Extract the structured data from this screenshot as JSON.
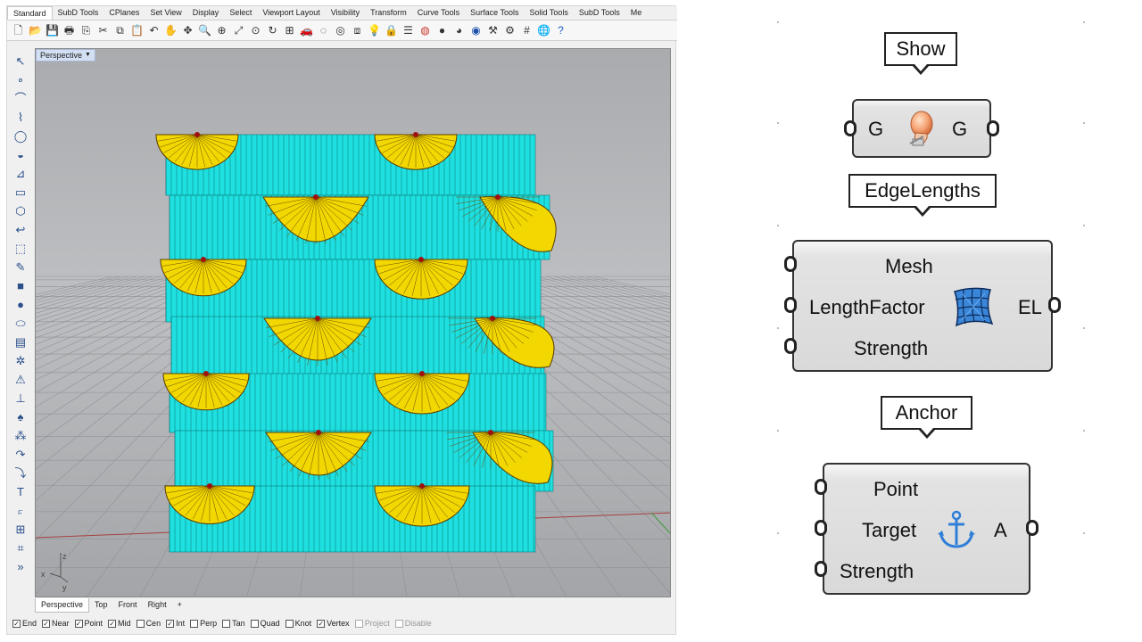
{
  "rhino": {
    "menu_tabs": [
      "Standard",
      "SubD Tools",
      "CPlanes",
      "Set View",
      "Display",
      "Select",
      "Viewport Layout",
      "Visibility",
      "Transform",
      "Curve Tools",
      "Surface Tools",
      "Solid Tools",
      "SubD Tools",
      "Me"
    ],
    "active_menu_tab": "Standard",
    "toolbar_icons": [
      "new-file-icon",
      "open-file-icon",
      "save-icon",
      "print-icon",
      "import-icon",
      "cut-icon",
      "copy-icon",
      "paste-icon",
      "undo-icon",
      "pan-icon",
      "move-view-icon",
      "zoom-icon",
      "zoom-window-icon",
      "zoom-extents-icon",
      "zoom-selected-icon",
      "rotate-view-icon",
      "four-viewports-icon",
      "car-icon",
      "hide-icon",
      "show-icon",
      "layer-icon",
      "light-icon",
      "lock-icon",
      "properties-icon",
      "render-color-icon",
      "shaded-sphere-icon",
      "render-sphere-icon",
      "globe-icon",
      "analyze-icon",
      "options-icon",
      "grid-icon",
      "earth-icon",
      "help-icon"
    ],
    "viewport_title": "Perspective",
    "view_tabs": [
      "Perspective",
      "Top",
      "Front",
      "Right"
    ],
    "active_view_tab": "Perspective",
    "view_tab_add": "+",
    "axis_labels": {
      "z": "z",
      "x": "x",
      "y": "y"
    },
    "osnaps": [
      {
        "label": "End",
        "checked": true,
        "enabled": true
      },
      {
        "label": "Near",
        "checked": true,
        "enabled": true
      },
      {
        "label": "Point",
        "checked": true,
        "enabled": true
      },
      {
        "label": "Mid",
        "checked": true,
        "enabled": true
      },
      {
        "label": "Cen",
        "checked": false,
        "enabled": true
      },
      {
        "label": "Int",
        "checked": true,
        "enabled": true
      },
      {
        "label": "Perp",
        "checked": false,
        "enabled": true
      },
      {
        "label": "Tan",
        "checked": false,
        "enabled": true
      },
      {
        "label": "Quad",
        "checked": false,
        "enabled": true
      },
      {
        "label": "Knot",
        "checked": false,
        "enabled": true
      },
      {
        "label": "Vertex",
        "checked": true,
        "enabled": true
      },
      {
        "label": "Project",
        "checked": false,
        "enabled": false
      },
      {
        "label": "Disable",
        "checked": false,
        "enabled": false
      }
    ],
    "colors": {
      "panel": "#1fe0e0",
      "fan": "#f2d800",
      "viewport_bg": "#b3b5b8"
    }
  },
  "grasshopper": {
    "show": {
      "tag": "Show",
      "input": "G",
      "output": "G",
      "icon": "light-bulb-icon"
    },
    "edge_lengths": {
      "tag": "EdgeLengths",
      "inputs": [
        "Mesh",
        "LengthFactor",
        "Strength"
      ],
      "output": "EL",
      "icon": "mesh-icon"
    },
    "anchor": {
      "tag": "Anchor",
      "inputs": [
        "Point",
        "Target",
        "Strength"
      ],
      "output": "A",
      "icon": "anchor-icon"
    }
  }
}
